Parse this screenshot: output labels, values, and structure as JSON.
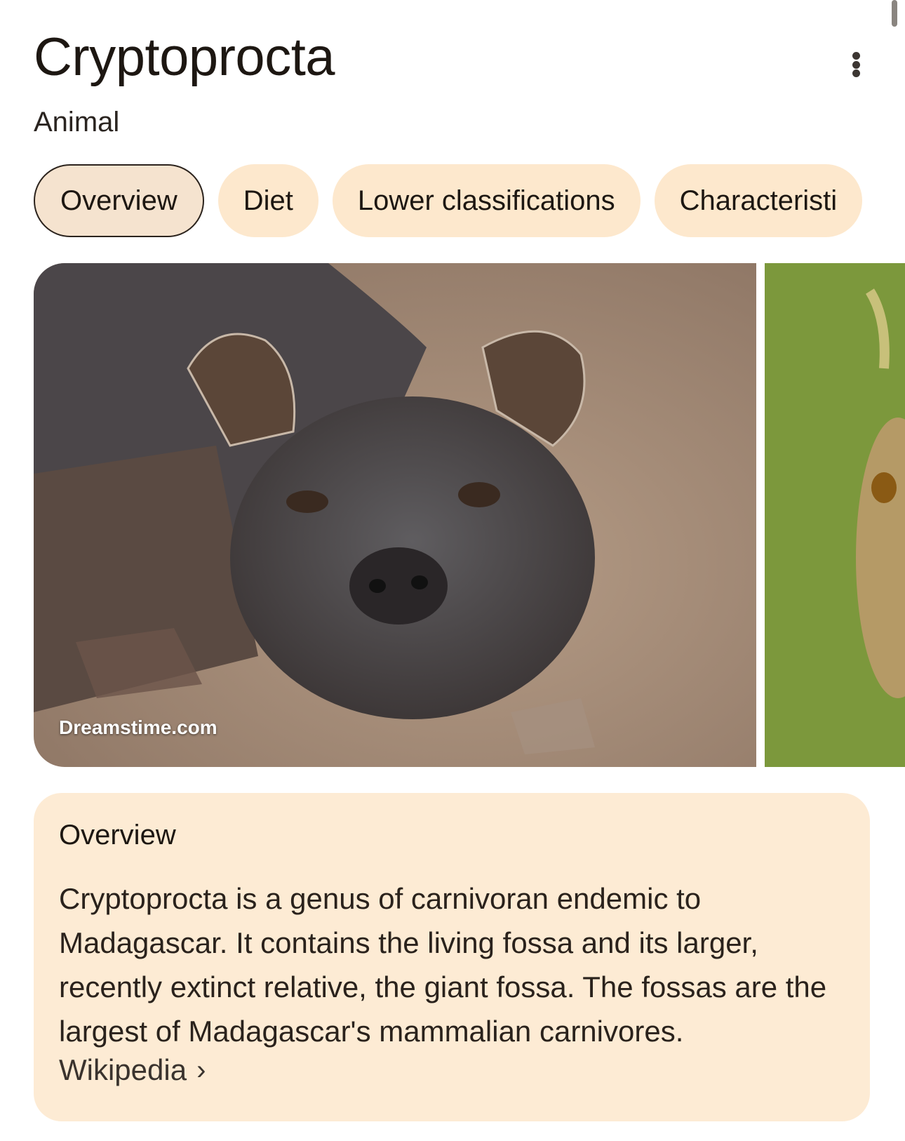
{
  "header": {
    "title": "Cryptoprocta",
    "subtitle": "Animal",
    "more_icon": "more-vert-icon"
  },
  "tabs": [
    {
      "label": "Overview",
      "active": true
    },
    {
      "label": "Diet",
      "active": false
    },
    {
      "label": "Lower classifications",
      "active": false
    },
    {
      "label": "Characteristi",
      "active": false
    }
  ],
  "images": {
    "primary_source": "Dreamstime.com"
  },
  "overview": {
    "heading": "Overview",
    "body": "Cryptoprocta is a genus of carnivoran endemic to Madagascar. It contains the living fossa and its larger, recently extinct relative, the giant fossa. The fossas are the largest of Madagascar's mammalian carnivores.",
    "source_label": "Wikipedia",
    "source_icon": "chevron-right-icon"
  },
  "colors": {
    "chip_background": "#fde8cd",
    "card_background": "#fdebd4",
    "text": "#1d1712"
  }
}
